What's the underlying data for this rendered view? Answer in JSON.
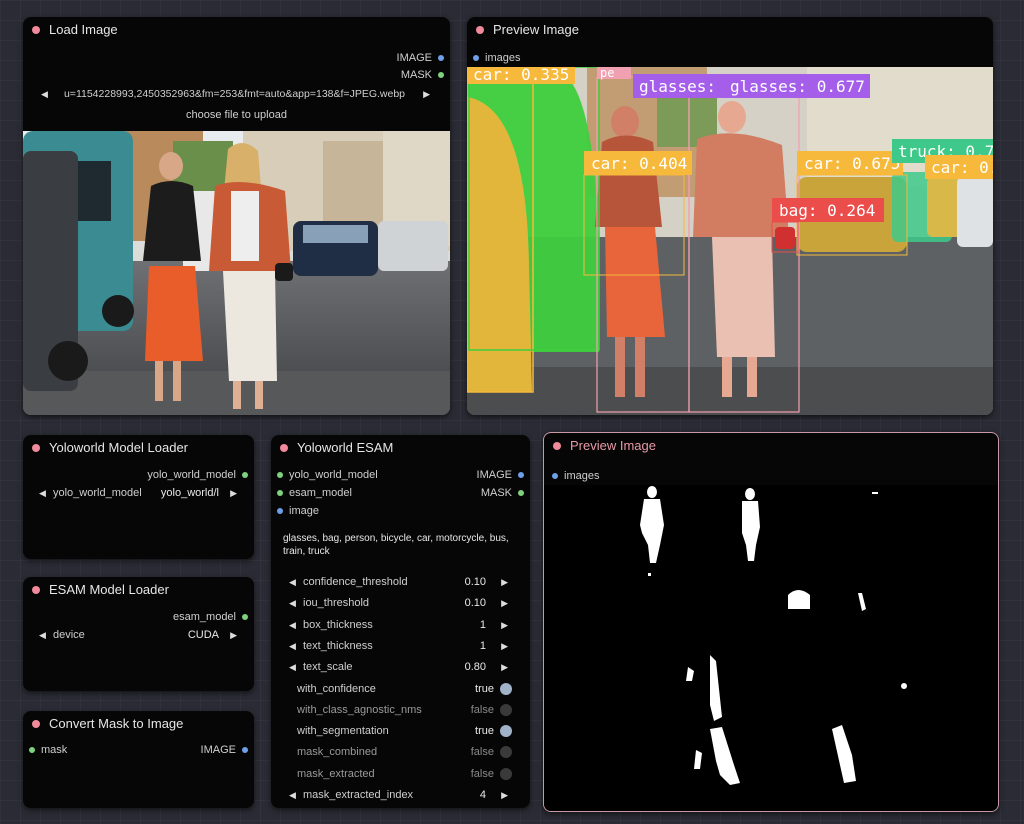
{
  "load_image": {
    "title": "Load Image",
    "outputs": [
      "IMAGE",
      "MASK"
    ],
    "filename": "u=1154228993,2450352963&fm=253&fmt=auto&app=138&f=JPEG.webp",
    "upload_label": "choose file to upload"
  },
  "preview1": {
    "title": "Preview Image",
    "input": "images",
    "labels": [
      {
        "text": "car: 0.335",
        "color": "#f6b93b"
      },
      {
        "text": "pe",
        "color": "#f0a0b0"
      },
      {
        "text": "glasses: (",
        "color": "#a55eea"
      },
      {
        "text": "glasses: 0.677",
        "color": "#a55eea"
      },
      {
        "text": "car: 0.404",
        "color": "#f6b93b"
      },
      {
        "text": "car: 0.675",
        "color": "#f6b93b"
      },
      {
        "text": "truck: 0.7",
        "color": "#3ec98a"
      },
      {
        "text": "car: 0.",
        "color": "#f6b93b"
      },
      {
        "text": "bag: 0.264",
        "color": "#eb4d4b"
      }
    ]
  },
  "yolo_loader": {
    "title": "Yoloworld Model Loader",
    "output": "yolo_world_model",
    "widget_label": "yolo_world_model",
    "widget_value": "yolo_world/l"
  },
  "esam_loader": {
    "title": "ESAM Model Loader",
    "output": "esam_model",
    "widget_label": "device",
    "widget_value": "CUDA"
  },
  "convert": {
    "title": "Convert Mask to Image",
    "input": "mask",
    "output": "IMAGE"
  },
  "yolo_esam": {
    "title": "Yoloworld ESAM",
    "inputs": [
      "yolo_world_model",
      "esam_model",
      "image"
    ],
    "outputs": [
      "IMAGE",
      "MASK"
    ],
    "categories": "glasses, bag, person,  bicycle, car, motorcycle, bus, train, truck",
    "widgets": [
      {
        "label": "confidence_threshold",
        "value": "0.10",
        "kind": "number"
      },
      {
        "label": "iou_threshold",
        "value": "0.10",
        "kind": "number"
      },
      {
        "label": "box_thickness",
        "value": "1",
        "kind": "number"
      },
      {
        "label": "text_thickness",
        "value": "1",
        "kind": "number"
      },
      {
        "label": "text_scale",
        "value": "0.80",
        "kind": "number"
      },
      {
        "label": "with_confidence",
        "value": "true",
        "kind": "toggle"
      },
      {
        "label": "with_class_agnostic_nms",
        "value": "false",
        "kind": "toggle"
      },
      {
        "label": "with_segmentation",
        "value": "true",
        "kind": "toggle"
      },
      {
        "label": "mask_combined",
        "value": "false",
        "kind": "toggle"
      },
      {
        "label": "mask_extracted",
        "value": "false",
        "kind": "toggle"
      },
      {
        "label": "mask_extracted_index",
        "value": "4",
        "kind": "number"
      }
    ]
  },
  "preview2": {
    "title": "Preview Image",
    "input": "images"
  },
  "colors": {
    "canvas": "#2b2b35",
    "node_bg": "#060606",
    "title_dot": "#f08a9a",
    "pin_blue": "#6ea0e8",
    "pin_green": "#7ed27e"
  }
}
